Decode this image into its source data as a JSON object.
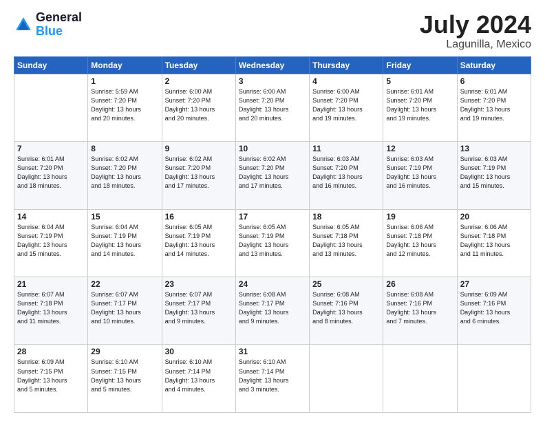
{
  "header": {
    "logo_line1": "General",
    "logo_line2": "Blue",
    "title": "July 2024",
    "subtitle": "Lagunilla, Mexico"
  },
  "days_of_week": [
    "Sunday",
    "Monday",
    "Tuesday",
    "Wednesday",
    "Thursday",
    "Friday",
    "Saturday"
  ],
  "weeks": [
    [
      {
        "day": "",
        "info": ""
      },
      {
        "day": "1",
        "info": "Sunrise: 5:59 AM\nSunset: 7:20 PM\nDaylight: 13 hours\nand 20 minutes."
      },
      {
        "day": "2",
        "info": "Sunrise: 6:00 AM\nSunset: 7:20 PM\nDaylight: 13 hours\nand 20 minutes."
      },
      {
        "day": "3",
        "info": "Sunrise: 6:00 AM\nSunset: 7:20 PM\nDaylight: 13 hours\nand 20 minutes."
      },
      {
        "day": "4",
        "info": "Sunrise: 6:00 AM\nSunset: 7:20 PM\nDaylight: 13 hours\nand 19 minutes."
      },
      {
        "day": "5",
        "info": "Sunrise: 6:01 AM\nSunset: 7:20 PM\nDaylight: 13 hours\nand 19 minutes."
      },
      {
        "day": "6",
        "info": "Sunrise: 6:01 AM\nSunset: 7:20 PM\nDaylight: 13 hours\nand 19 minutes."
      }
    ],
    [
      {
        "day": "7",
        "info": "Sunrise: 6:01 AM\nSunset: 7:20 PM\nDaylight: 13 hours\nand 18 minutes."
      },
      {
        "day": "8",
        "info": "Sunrise: 6:02 AM\nSunset: 7:20 PM\nDaylight: 13 hours\nand 18 minutes."
      },
      {
        "day": "9",
        "info": "Sunrise: 6:02 AM\nSunset: 7:20 PM\nDaylight: 13 hours\nand 17 minutes."
      },
      {
        "day": "10",
        "info": "Sunrise: 6:02 AM\nSunset: 7:20 PM\nDaylight: 13 hours\nand 17 minutes."
      },
      {
        "day": "11",
        "info": "Sunrise: 6:03 AM\nSunset: 7:20 PM\nDaylight: 13 hours\nand 16 minutes."
      },
      {
        "day": "12",
        "info": "Sunrise: 6:03 AM\nSunset: 7:19 PM\nDaylight: 13 hours\nand 16 minutes."
      },
      {
        "day": "13",
        "info": "Sunrise: 6:03 AM\nSunset: 7:19 PM\nDaylight: 13 hours\nand 15 minutes."
      }
    ],
    [
      {
        "day": "14",
        "info": "Sunrise: 6:04 AM\nSunset: 7:19 PM\nDaylight: 13 hours\nand 15 minutes."
      },
      {
        "day": "15",
        "info": "Sunrise: 6:04 AM\nSunset: 7:19 PM\nDaylight: 13 hours\nand 14 minutes."
      },
      {
        "day": "16",
        "info": "Sunrise: 6:05 AM\nSunset: 7:19 PM\nDaylight: 13 hours\nand 14 minutes."
      },
      {
        "day": "17",
        "info": "Sunrise: 6:05 AM\nSunset: 7:19 PM\nDaylight: 13 hours\nand 13 minutes."
      },
      {
        "day": "18",
        "info": "Sunrise: 6:05 AM\nSunset: 7:18 PM\nDaylight: 13 hours\nand 13 minutes."
      },
      {
        "day": "19",
        "info": "Sunrise: 6:06 AM\nSunset: 7:18 PM\nDaylight: 13 hours\nand 12 minutes."
      },
      {
        "day": "20",
        "info": "Sunrise: 6:06 AM\nSunset: 7:18 PM\nDaylight: 13 hours\nand 11 minutes."
      }
    ],
    [
      {
        "day": "21",
        "info": "Sunrise: 6:07 AM\nSunset: 7:18 PM\nDaylight: 13 hours\nand 11 minutes."
      },
      {
        "day": "22",
        "info": "Sunrise: 6:07 AM\nSunset: 7:17 PM\nDaylight: 13 hours\nand 10 minutes."
      },
      {
        "day": "23",
        "info": "Sunrise: 6:07 AM\nSunset: 7:17 PM\nDaylight: 13 hours\nand 9 minutes."
      },
      {
        "day": "24",
        "info": "Sunrise: 6:08 AM\nSunset: 7:17 PM\nDaylight: 13 hours\nand 9 minutes."
      },
      {
        "day": "25",
        "info": "Sunrise: 6:08 AM\nSunset: 7:16 PM\nDaylight: 13 hours\nand 8 minutes."
      },
      {
        "day": "26",
        "info": "Sunrise: 6:08 AM\nSunset: 7:16 PM\nDaylight: 13 hours\nand 7 minutes."
      },
      {
        "day": "27",
        "info": "Sunrise: 6:09 AM\nSunset: 7:16 PM\nDaylight: 13 hours\nand 6 minutes."
      }
    ],
    [
      {
        "day": "28",
        "info": "Sunrise: 6:09 AM\nSunset: 7:15 PM\nDaylight: 13 hours\nand 5 minutes."
      },
      {
        "day": "29",
        "info": "Sunrise: 6:10 AM\nSunset: 7:15 PM\nDaylight: 13 hours\nand 5 minutes."
      },
      {
        "day": "30",
        "info": "Sunrise: 6:10 AM\nSunset: 7:14 PM\nDaylight: 13 hours\nand 4 minutes."
      },
      {
        "day": "31",
        "info": "Sunrise: 6:10 AM\nSunset: 7:14 PM\nDaylight: 13 hours\nand 3 minutes."
      },
      {
        "day": "",
        "info": ""
      },
      {
        "day": "",
        "info": ""
      },
      {
        "day": "",
        "info": ""
      }
    ]
  ]
}
